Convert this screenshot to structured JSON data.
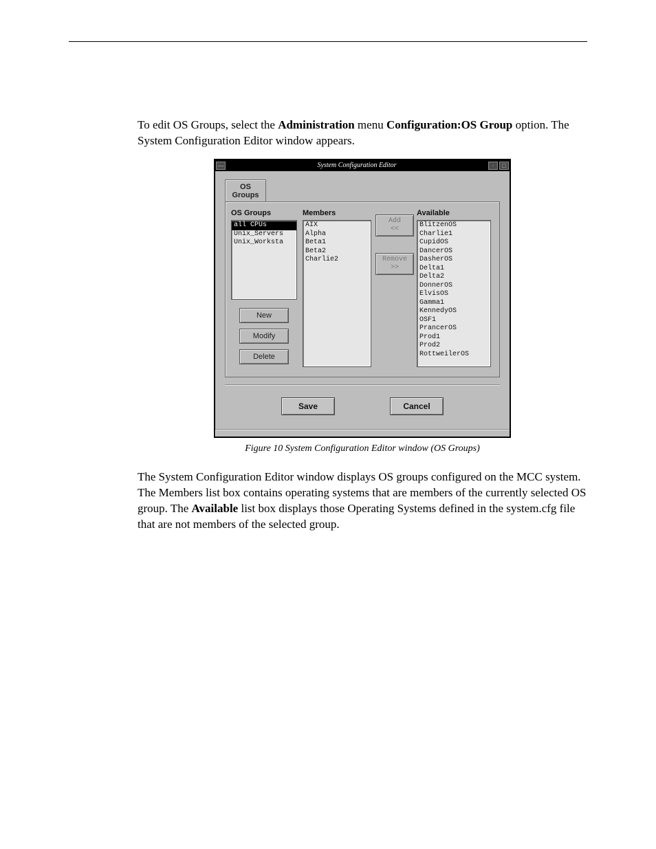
{
  "intro": {
    "prefix": "To edit OS Groups, select the ",
    "bold1": "Administration",
    "mid1": " menu ",
    "bold2": "Configuration:OS Group",
    "suffix": " option. The System Configuration Editor window appears."
  },
  "dialog": {
    "title": "System Configuration Editor",
    "tab": "OS Groups",
    "headers": {
      "groups": "OS Groups",
      "members": "Members",
      "available": "Available"
    },
    "groups": [
      "all CPUs",
      "Unix_Servers",
      "Unix_Worksta"
    ],
    "groups_selected_index": 0,
    "members": [
      "AIX",
      "Alpha",
      "Beta1",
      "Beta2",
      "Charlie2"
    ],
    "available": [
      "BlitzenOS",
      "Charlie1",
      "CupidOS",
      "DancerOS",
      "DasherOS",
      "Delta1",
      "Delta2",
      "DonnerOS",
      "ElvisOS",
      "Gamma1",
      "KennedyOS",
      "OSF1",
      "PrancerOS",
      "Prod1",
      "Prod2",
      "RottweilerOS"
    ],
    "buttons": {
      "add": "Add",
      "add_sym": "<<",
      "remove": "Remove",
      "remove_sym": ">>",
      "new": "New",
      "modify": "Modify",
      "delete": "Delete",
      "save": "Save",
      "cancel": "Cancel"
    }
  },
  "caption": "Figure 10 System Configuration Editor window (OS Groups)",
  "para2": {
    "pre": "The System Configuration Editor window displays OS groups configured on the MCC system. The Members list box contains operating systems that are members of the currently selected OS group. The ",
    "bold": "Available",
    "post": " list box displays those Operating Systems defined in the system.cfg file that are not members of the selected group."
  }
}
